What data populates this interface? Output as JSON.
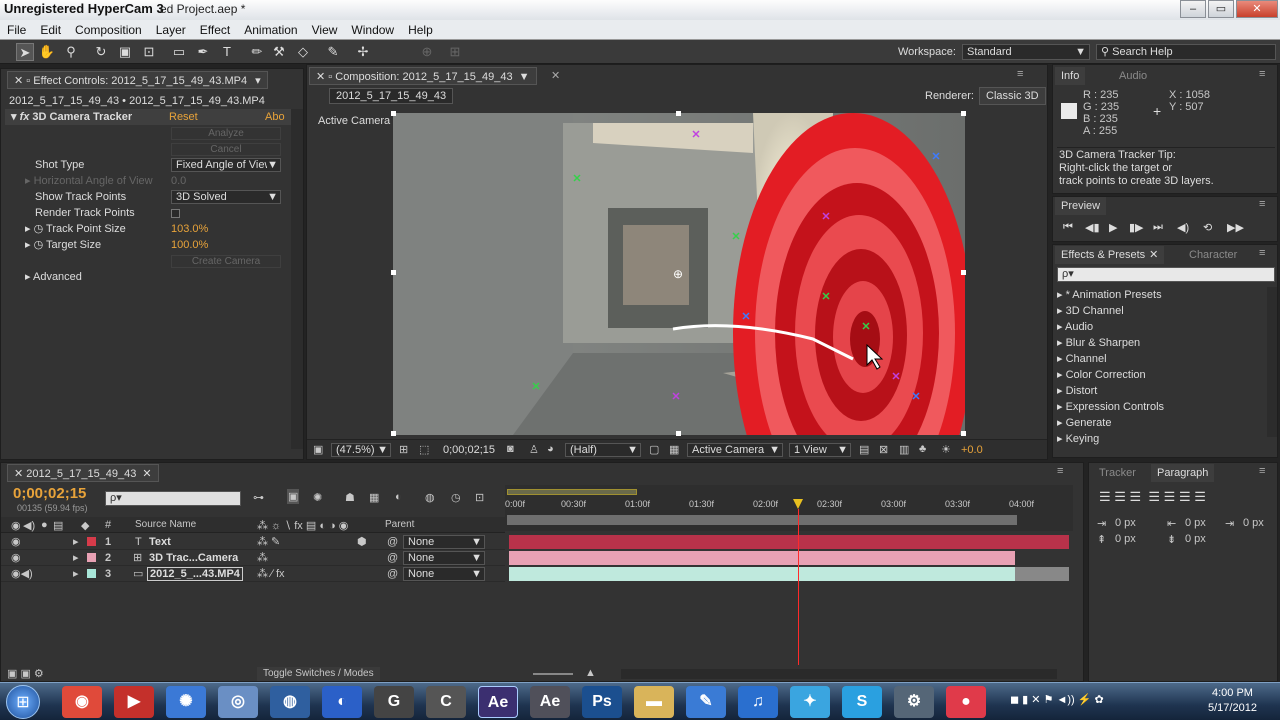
{
  "window": {
    "title": "Unregistered HyperCam 3",
    "title_tail": "ed Project.aep *",
    "min": "–",
    "max": "▭",
    "close": "✕"
  },
  "menu": [
    "File",
    "Edit",
    "Composition",
    "Layer",
    "Effect",
    "Animation",
    "View",
    "Window",
    "Help"
  ],
  "workspace": {
    "label": "Workspace:",
    "value": "Standard"
  },
  "search_help": "Search Help",
  "effect_controls": {
    "tab": "Effect Controls: 2012_5_17_15_49_43.MP4",
    "subheader": "2012_5_17_15_49_43 • 2012_5_17_15_49_43.MP4",
    "fx_name": "3D Camera Tracker",
    "reset": "Reset",
    "about": "Abo",
    "analyze": "Analyze",
    "cancel": "Cancel",
    "shot_type_label": "Shot Type",
    "shot_type_value": "Fixed Angle of View",
    "hav_label": "Horizontal Angle of View",
    "hav_value": "0.0",
    "show_tp_label": "Show Track Points",
    "show_tp_value": "3D Solved",
    "render_tp_label": "Render Track Points",
    "tp_size_label": "Track Point Size",
    "tp_size_value": "103.0%",
    "target_size_label": "Target Size",
    "target_size_value": "100.0%",
    "create_camera": "Create Camera",
    "advanced": "Advanced"
  },
  "composition": {
    "tab": "Composition: 2012_5_17_15_49_43",
    "subtab": "2012_5_17_15_49_43",
    "renderer_label": "Renderer:",
    "renderer_value": "Classic 3D",
    "active_camera": "Active Camera",
    "zoom": "(47.5%)",
    "timecode": "0;00;02;15",
    "resolution": "(Half)",
    "camera_view": "Active Camera",
    "views": "1 View",
    "exposure": "+0.0"
  },
  "info": {
    "tab_info": "Info",
    "tab_audio": "Audio",
    "r": "R : 235",
    "g": "G : 235",
    "b": "B : 235",
    "a": "A : 255",
    "x": "X : 1058",
    "y": "Y : 507",
    "tip_title": "3D Camera Tracker Tip:",
    "tip_line1": "Right-click the target or",
    "tip_line2": "track points to create 3D layers."
  },
  "preview": {
    "tab": "Preview"
  },
  "effects_presets": {
    "tab": "Effects & Presets",
    "tab2": "Character",
    "search_placeholder": "ρ▾",
    "items": [
      "* Animation Presets",
      "3D Channel",
      "Audio",
      "Blur & Sharpen",
      "Channel",
      "Color Correction",
      "Distort",
      "Expression Controls",
      "Generate",
      "Keying"
    ]
  },
  "timeline": {
    "tab": "2012_5_17_15_49_43",
    "timecode": "0;00;02;15",
    "frames": "00135 (59.94 fps)",
    "col_source": "Source Name",
    "col_parent": "Parent",
    "ruler": [
      "0:00f",
      "00:30f",
      "01:00f",
      "01:30f",
      "02:00f",
      "02:30f",
      "03:00f",
      "03:30f",
      "04:00f"
    ],
    "layers": [
      {
        "num": "1",
        "name": "Text",
        "parent": "None",
        "color": "#d63b4a"
      },
      {
        "num": "2",
        "name": "3D Trac...Camera",
        "parent": "None",
        "color": "#e8a1b4"
      },
      {
        "num": "3",
        "name": "2012_5_...43.MP4",
        "parent": "None",
        "color": "#a8e6d8"
      }
    ],
    "toggle": "Toggle Switches / Modes"
  },
  "tracker": {
    "tab": "Tracker",
    "tab2": "Paragraph",
    "px_values": [
      "0 px",
      "0 px",
      "0 px",
      "0 px",
      "0 px"
    ]
  },
  "clock": {
    "time": "4:00 PM",
    "date": "5/17/2012"
  },
  "taskbar_icons": [
    {
      "name": "chrome",
      "label": "◉",
      "color": "#e04a3a"
    },
    {
      "name": "youtube",
      "label": "▶",
      "color": "#c4302b"
    },
    {
      "name": "network",
      "label": "✺",
      "color": "#3b79d6"
    },
    {
      "name": "safari",
      "label": "◎",
      "color": "#6a8fc4"
    },
    {
      "name": "blender",
      "label": "◍",
      "color": "#2f5f9f"
    },
    {
      "name": "firefox",
      "label": "◐",
      "color": "#2b60c8"
    },
    {
      "name": "cinema4d",
      "label": "G",
      "color": "#444444"
    },
    {
      "name": "gimp",
      "label": "C",
      "color": "#555555"
    },
    {
      "name": "after-effects",
      "label": "Ae",
      "color": "#3b2f70"
    },
    {
      "name": "after-effects-2",
      "label": "Ae",
      "color": "#50505a"
    },
    {
      "name": "photoshop",
      "label": "Ps",
      "color": "#1b4f8f"
    },
    {
      "name": "folder",
      "label": "▬",
      "color": "#d9b45a"
    },
    {
      "name": "notepad",
      "label": "✎",
      "color": "#3a7bd5"
    },
    {
      "name": "itunes",
      "label": "♫",
      "color": "#2a6fcf"
    },
    {
      "name": "twitter",
      "label": "✦",
      "color": "#3aa5e0"
    },
    {
      "name": "skype",
      "label": "S",
      "color": "#2aa0e0"
    },
    {
      "name": "tool",
      "label": "⚙",
      "color": "#556677"
    },
    {
      "name": "record",
      "label": "●",
      "color": "#e03a4a"
    }
  ]
}
